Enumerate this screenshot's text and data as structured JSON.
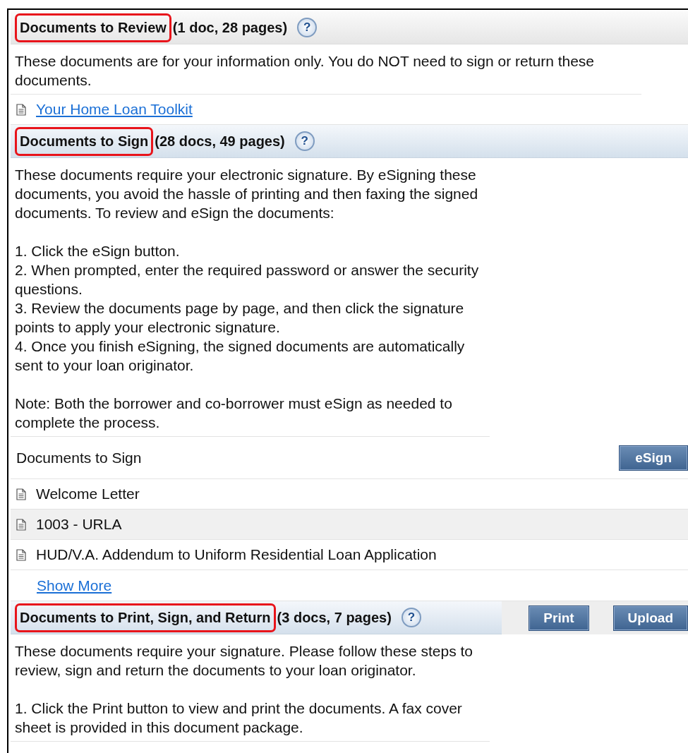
{
  "sections": [
    {
      "title": "Documents to Review",
      "count": "(1 doc, 28 pages)",
      "help": "?",
      "highlighted": true,
      "kind": "gray",
      "blocks": [
        {
          "kind": "text",
          "wide": true,
          "groups": [
            [
              "These documents are for your information only. You do NOT need to sign or return these documents."
            ]
          ]
        },
        {
          "kind": "documents",
          "items": [
            {
              "name": "Your Home Loan Toolkit",
              "link": true
            }
          ]
        }
      ]
    },
    {
      "title": "Documents to Sign",
      "count": "(28 docs, 49 pages)",
      "help": "?",
      "highlighted": true,
      "kind": "blue",
      "blocks": [
        {
          "kind": "text",
          "wide": false,
          "groups": [
            [
              "These documents require your electronic signature. By eSigning these documents, you avoid the hassle of printing and then faxing the signed documents. To review and eSign the documents:"
            ],
            [
              "1. Click the eSign button.",
              "2. When prompted, enter the required password or answer the security questions.",
              "3. Review the documents page by page, and then click the signature points to apply your electronic signature.",
              "4. Once you finish eSigning, the signed documents are automatically sent to your loan originator."
            ],
            [
              "Note: Both the borrower and co-borrower must eSign as needed to complete the process."
            ]
          ]
        },
        {
          "kind": "list-header",
          "label": "Documents to Sign",
          "button": "eSign"
        },
        {
          "kind": "documents",
          "items": [
            {
              "name": "Welcome Letter",
              "link": false
            },
            {
              "name": "1003 - URLA",
              "link": false
            },
            {
              "name": "HUD/V.A. Addendum to Uniform Residential Loan Application",
              "link": false
            }
          ]
        },
        {
          "kind": "link",
          "text": "Show More"
        }
      ]
    },
    {
      "title": "Documents to Print, Sign, and Return",
      "count": "(3 docs, 7 pages)",
      "help": "?",
      "highlighted": true,
      "kind": "blue",
      "buttons": [
        "Print",
        "Upload"
      ],
      "blocks": [
        {
          "kind": "text",
          "wide": false,
          "groups": [
            [
              "These documents require your signature. Please follow these steps to review, sign and return the documents to your loan originator."
            ],
            [
              "1. Click the Print button to view and print the documents. A fax cover sheet is provided in this document package."
            ]
          ]
        }
      ]
    }
  ]
}
